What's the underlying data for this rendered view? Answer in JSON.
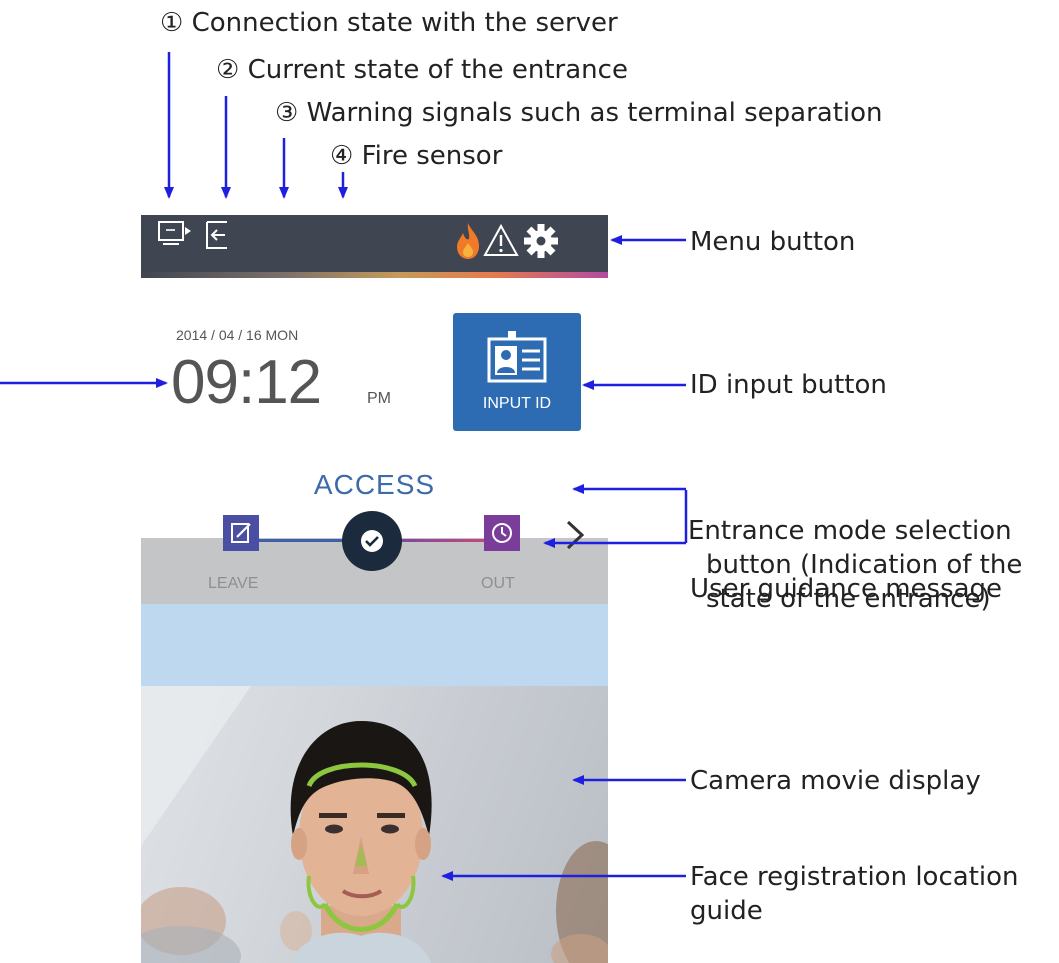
{
  "callouts": {
    "c1": "① Connection state with the server",
    "c2": "② Current state of the entrance",
    "c3": "③ Warning signals such as terminal separation",
    "c4": "④ Fire sensor",
    "menu": "Menu button",
    "id_input": "ID input button",
    "mode_select": "Entrance mode selection button (Indication of the state of the entrance)",
    "guidance": "User guidance message",
    "camera": "Camera movie display",
    "face_guide": "Face registration location guide"
  },
  "device": {
    "date": "2014 / 04 / 16 MON",
    "time": "09:12",
    "ampm": "PM",
    "id_button_label": "INPUT ID",
    "mode_title": "ACCESS",
    "mode_left_label": "LEAVE",
    "mode_right_label": "OUT",
    "icons": {
      "server": "monitor-connection-icon",
      "entrance": "entrance-door-icon",
      "fire": "fire-icon",
      "warning": "warning-triangle-icon",
      "menu": "gear-icon",
      "id_card": "id-card-icon",
      "leave": "edit-note-icon",
      "access": "check-circle-icon",
      "out": "clock-icon",
      "next": "chevron-right-icon"
    },
    "colors": {
      "topbar": "#3f4651",
      "id_button": "#2d6bb3",
      "mode_leave": "#4a4fa3",
      "mode_out": "#7a3e9a",
      "guidance_bg": "#bed8ef",
      "face_guide": "#8dc63f",
      "arrow": "#1f1fe0"
    }
  }
}
